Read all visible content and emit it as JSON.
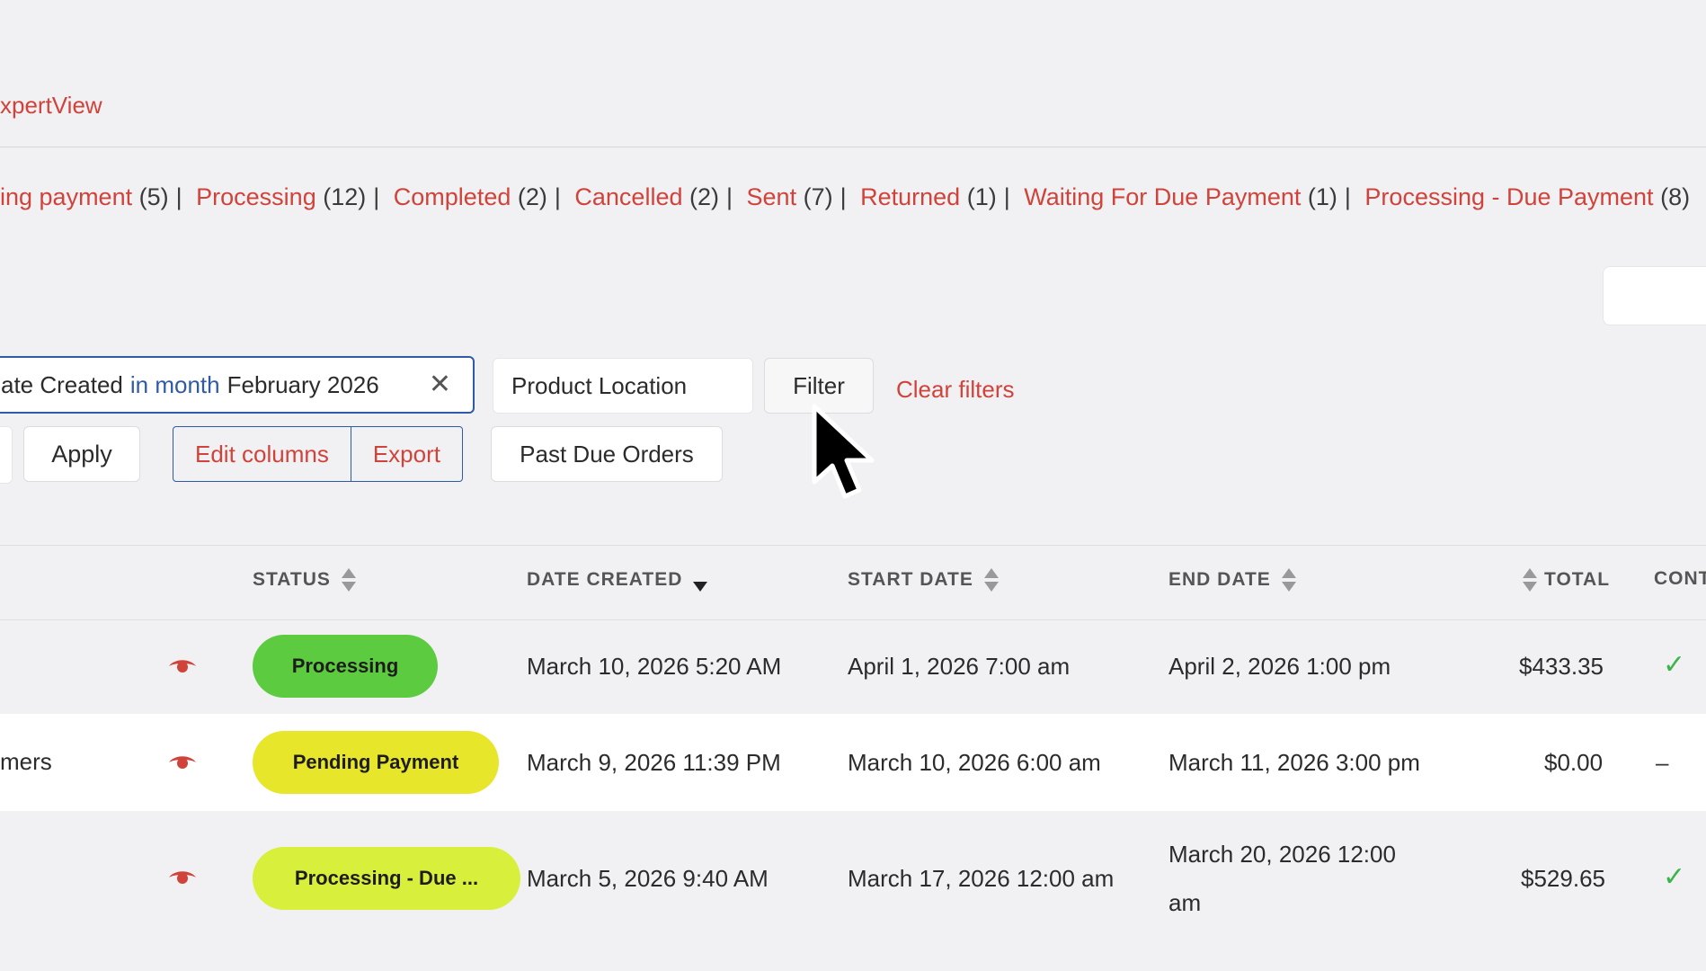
{
  "header": {
    "brand": "xpertView"
  },
  "status_filters": [
    {
      "label": "ing payment",
      "count": "(5)"
    },
    {
      "label": "Processing",
      "count": "(12)"
    },
    {
      "label": "Completed",
      "count": "(2)"
    },
    {
      "label": "Cancelled",
      "count": "(2)"
    },
    {
      "label": "Sent",
      "count": "(7)"
    },
    {
      "label": "Returned",
      "count": "(1)"
    },
    {
      "label": "Waiting For Due Payment",
      "count": "(1)"
    },
    {
      "label": "Processing - Due Payment",
      "count": "(8)"
    }
  ],
  "filters": {
    "date_filter": {
      "field": "ate Created",
      "operator": "in month",
      "value": "February 2026"
    },
    "product_location_placeholder": "Product Location",
    "filter_label": "Filter",
    "clear_label": "Clear filters"
  },
  "actions": {
    "apply": "Apply",
    "edit_columns": "Edit columns",
    "export": "Export",
    "past_due": "Past Due Orders"
  },
  "table": {
    "headers": {
      "status": "STATUS",
      "date_created": "DATE CREATED",
      "start_date": "START DATE",
      "end_date": "END DATE",
      "total": "TOTAL",
      "cont": "CONT"
    },
    "rows": [
      {
        "name": "",
        "status": "Processing",
        "status_color": "#5ccb3f",
        "date_created": "March 10, 2026 5:20 AM",
        "start_date": "April 1, 2026 7:00 am",
        "end_date_line1": "April 2, 2026 1:00 pm",
        "end_date_line2": "",
        "total": "$433.35",
        "cont": "✓"
      },
      {
        "name": "mers",
        "status": "Pending Payment",
        "status_color": "#e8e62a",
        "date_created": "March 9, 2026 11:39 PM",
        "start_date": "March 10, 2026 6:00 am",
        "end_date_line1": "March 11, 2026 3:00 pm",
        "end_date_line2": "",
        "total": "$0.00",
        "cont": "–"
      },
      {
        "name": "",
        "status": "Processing - Due ...",
        "status_color": "#d8ef3c",
        "date_created": "March 5, 2026 9:40 AM",
        "start_date": "March 17, 2026 12:00 am",
        "end_date_line1": "March 20, 2026 12:00",
        "end_date_line2": "am",
        "total": "$529.65",
        "cont": "✓"
      }
    ]
  },
  "colors": {
    "accent_red": "#d0433b",
    "accent_blue": "#2f5aa8",
    "check_green": "#3bb54a"
  }
}
